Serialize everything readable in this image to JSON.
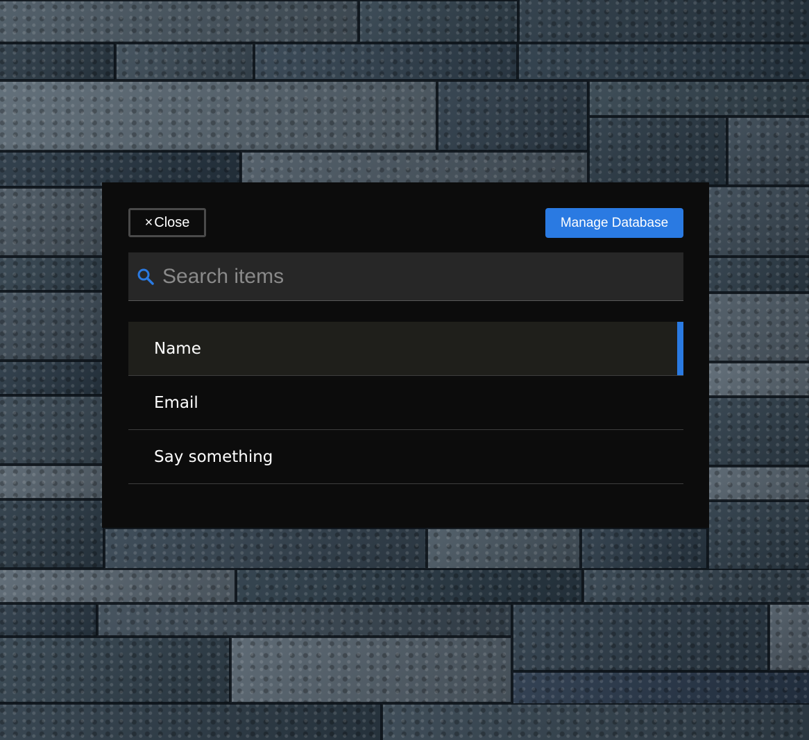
{
  "header": {
    "close_label": "Close",
    "close_icon": "×",
    "manage_label": "Manage Database"
  },
  "search": {
    "placeholder": "Search items",
    "value": "",
    "icon": "search-icon"
  },
  "items": [
    {
      "label": "Name",
      "selected": true
    },
    {
      "label": "Email",
      "selected": false
    },
    {
      "label": "Say something",
      "selected": false
    }
  ],
  "colors": {
    "accent": "#2a7ae2",
    "panel": "#0c0c0c",
    "search_bg": "#272727"
  }
}
